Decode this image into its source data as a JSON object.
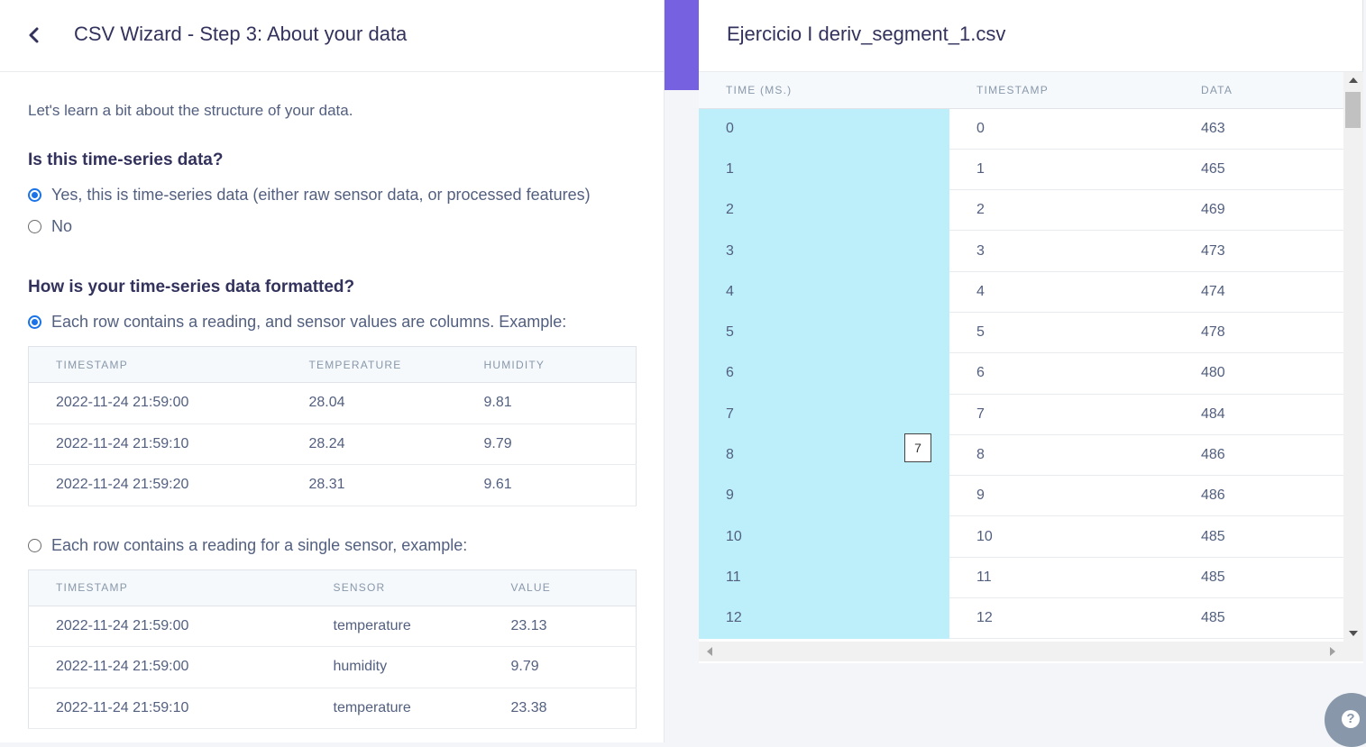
{
  "wizard": {
    "title": "CSV Wizard - Step 3: About your data",
    "intro": "Let's learn a bit about the structure of your data.",
    "q1": "Is this time-series data?",
    "q1_options": [
      "Yes, this is time-series data (either raw sensor data, or processed features)",
      "No"
    ],
    "q2": "How is your time-series data formatted?",
    "q2_option_a": "Each row contains a reading, and sensor values are columns. Example:",
    "example_a": {
      "headers": [
        "TIMESTAMP",
        "TEMPERATURE",
        "HUMIDITY"
      ],
      "rows": [
        [
          "2022-11-24 21:59:00",
          "28.04",
          "9.81"
        ],
        [
          "2022-11-24 21:59:10",
          "28.24",
          "9.79"
        ],
        [
          "2022-11-24 21:59:20",
          "28.31",
          "9.61"
        ]
      ]
    },
    "q2_option_b": "Each row contains a reading for a single sensor, example:",
    "example_b": {
      "headers": [
        "TIMESTAMP",
        "SENSOR",
        "VALUE"
      ],
      "rows": [
        [
          "2022-11-24 21:59:00",
          "temperature",
          "23.13"
        ],
        [
          "2022-11-24 21:59:00",
          "humidity",
          "9.79"
        ],
        [
          "2022-11-24 21:59:10",
          "temperature",
          "23.38"
        ]
      ]
    }
  },
  "preview": {
    "file_name": "Ejercicio I deriv_segment_1.csv",
    "headers": [
      "TIME (MS.)",
      "TIMESTAMP",
      "DATA"
    ],
    "rows": [
      [
        "0",
        "0",
        "463"
      ],
      [
        "1",
        "1",
        "465"
      ],
      [
        "2",
        "2",
        "469"
      ],
      [
        "3",
        "3",
        "473"
      ],
      [
        "4",
        "4",
        "474"
      ],
      [
        "5",
        "5",
        "478"
      ],
      [
        "6",
        "6",
        "480"
      ],
      [
        "7",
        "7",
        "484"
      ],
      [
        "8",
        "8",
        "486"
      ],
      [
        "9",
        "9",
        "486"
      ],
      [
        "10",
        "10",
        "485"
      ],
      [
        "11",
        "11",
        "485"
      ],
      [
        "12",
        "12",
        "485"
      ]
    ],
    "tooltip": "7"
  },
  "colors": {
    "accent": "#7661e0",
    "selected_column": "#bdeffa",
    "radio": "#1a73e8"
  },
  "icons": {
    "back": "chevron-left-icon",
    "help": "question-circle-icon"
  }
}
